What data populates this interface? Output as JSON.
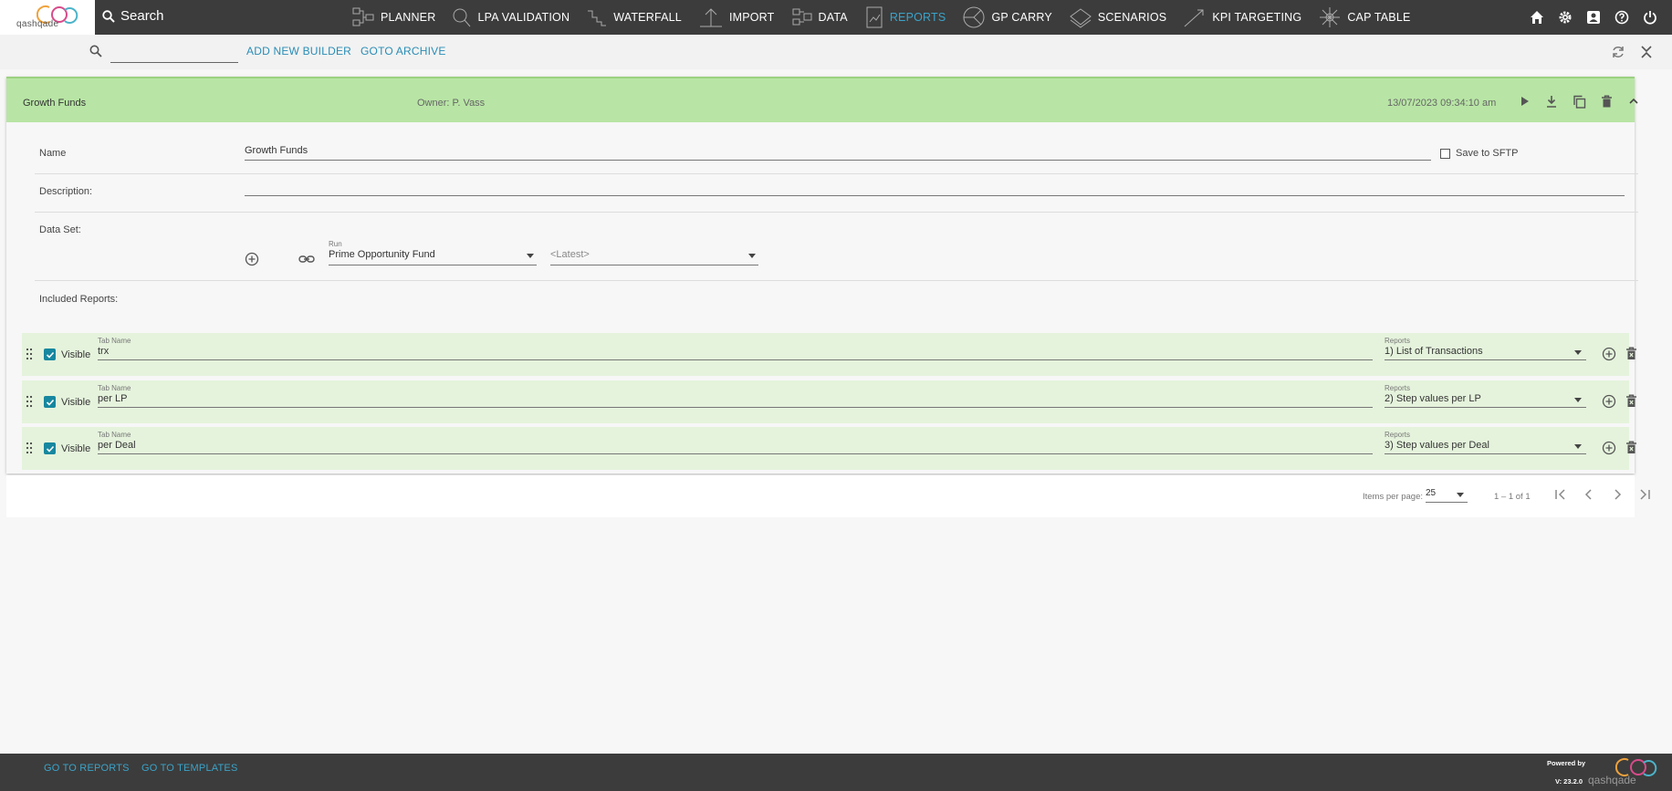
{
  "brand": {
    "name": "qashqade",
    "version": "V: 23.2.0",
    "powered_by": "Powered by"
  },
  "topbar": {
    "search_label": "Search",
    "nav": [
      {
        "label": "PLANNER",
        "icon": "planner-icon",
        "active": false
      },
      {
        "label": "LPA VALIDATION",
        "icon": "lpa-validation-icon",
        "active": false
      },
      {
        "label": "WATERFALL",
        "icon": "waterfall-icon",
        "active": false
      },
      {
        "label": "IMPORT",
        "icon": "import-icon",
        "active": false
      },
      {
        "label": "DATA",
        "icon": "data-icon",
        "active": false
      },
      {
        "label": "REPORTS",
        "icon": "reports-icon",
        "active": true
      },
      {
        "label": "GP CARRY",
        "icon": "gp-carry-icon",
        "active": false
      },
      {
        "label": "SCENARIOS",
        "icon": "scenarios-icon",
        "active": false
      },
      {
        "label": "KPI TARGETING",
        "icon": "kpi-targeting-icon",
        "active": false
      },
      {
        "label": "CAP TABLE",
        "icon": "cap-table-icon",
        "active": false
      }
    ],
    "right_icons": [
      "home-icon",
      "gear-icon",
      "user-icon",
      "help-icon",
      "power-icon"
    ]
  },
  "toolbar": {
    "search_value": "",
    "add_new_builder": "ADD NEW BUILDER",
    "goto_archive": "GOTO ARCHIVE"
  },
  "builder": {
    "title": "Growth Funds",
    "owner": "Owner: P. Vass",
    "timestamp": "13/07/2023 09:34:10 am",
    "name_label": "Name",
    "name_value": "Growth Funds",
    "save_sftp_label": "Save to SFTP",
    "save_sftp_checked": false,
    "description_label": "Description:",
    "description_value": "",
    "dataset_label": "Data Set:",
    "run_label": "Run",
    "run_value": "Prime Opportunity Fund",
    "version_value": "<Latest>",
    "included_reports_label": "Included Reports:",
    "tab_name_label": "Tab Name",
    "reports_label": "Reports",
    "visible_label": "Visible",
    "reports": [
      {
        "tab_name": "trx",
        "report": "1) List of Transactions",
        "visible": true
      },
      {
        "tab_name": "per LP",
        "report": "2) Step values per LP",
        "visible": true
      },
      {
        "tab_name": "per Deal",
        "report": "3) Step values per Deal",
        "visible": true
      }
    ]
  },
  "pager": {
    "items_per_page_label": "Items per page:",
    "items_per_page": "25",
    "range": "1 – 1 of 1"
  },
  "footer": {
    "go_to_reports": "GO TO REPORTS",
    "go_to_templates": "GO TO TEMPLATES"
  }
}
